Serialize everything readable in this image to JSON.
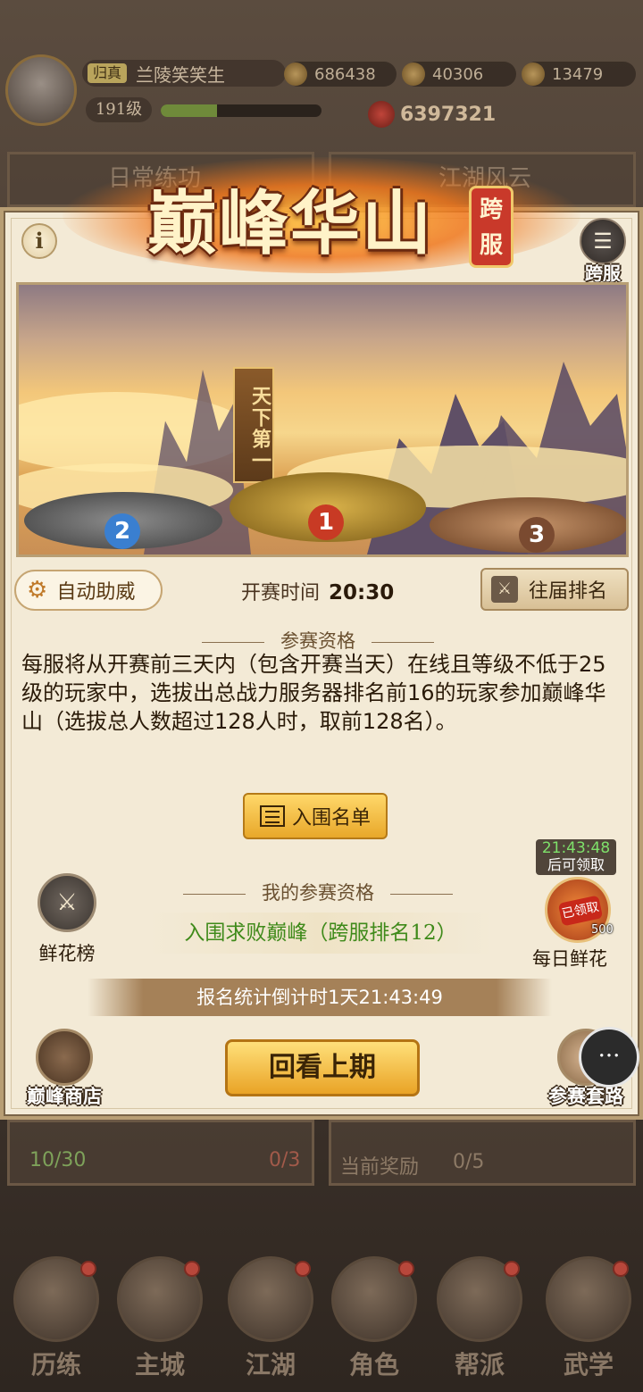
{
  "player": {
    "title": "归真",
    "name": "兰陵笑笑生",
    "level": "191级",
    "exp_fraction": 0.35,
    "currency1": "686438",
    "currency2": "40306",
    "currency3": "13479",
    "power": "6397321"
  },
  "background": {
    "card1_label": "日常练功",
    "card2_label": "江湖风云",
    "energy": "10/30",
    "counter2": "0/3",
    "current_reward": "当前奖励",
    "reward_count": "0/5"
  },
  "panel": {
    "title": "巅峰华山",
    "badge": "跨服",
    "cross_server_label": "跨服",
    "rank1_flag": "天下第一",
    "podium_ranks": [
      "2",
      "1",
      "3"
    ],
    "auto_cheer": "自动助威",
    "start_time_label": "开赛时间",
    "start_time_value": "20:30",
    "past_rankings": "往届排名",
    "eligibility_title": "参赛资格",
    "eligibility_rules": "每服将从开赛前三天内（包含开赛当天）在线且等级不低于25级的玩家中，选拔出总战力服务器排名前16的玩家参加巅峰华山（选拔总人数超过128人时，取前128名）。",
    "shortlist_button": "入围名单",
    "my_eligibility_title": "我的参赛资格",
    "my_eligibility_value": "入围求败巅峰（跨服排名12）",
    "flower_board": "鲜花榜",
    "flower_timer": "21:43:48",
    "flower_timer_note": "后可领取",
    "flower_stamp": "已领取",
    "flower_count": "500",
    "daily_flower": "每日鲜花",
    "countdown": "报名统计倒计时1天21:43:49",
    "review_button": "回看上期",
    "shop": "巅峰商店",
    "guide": "参赛套路"
  },
  "nav": [
    "历练",
    "主城",
    "江湖",
    "角色",
    "帮派",
    "武学"
  ],
  "icons": {
    "info": "i",
    "chat": "···"
  }
}
